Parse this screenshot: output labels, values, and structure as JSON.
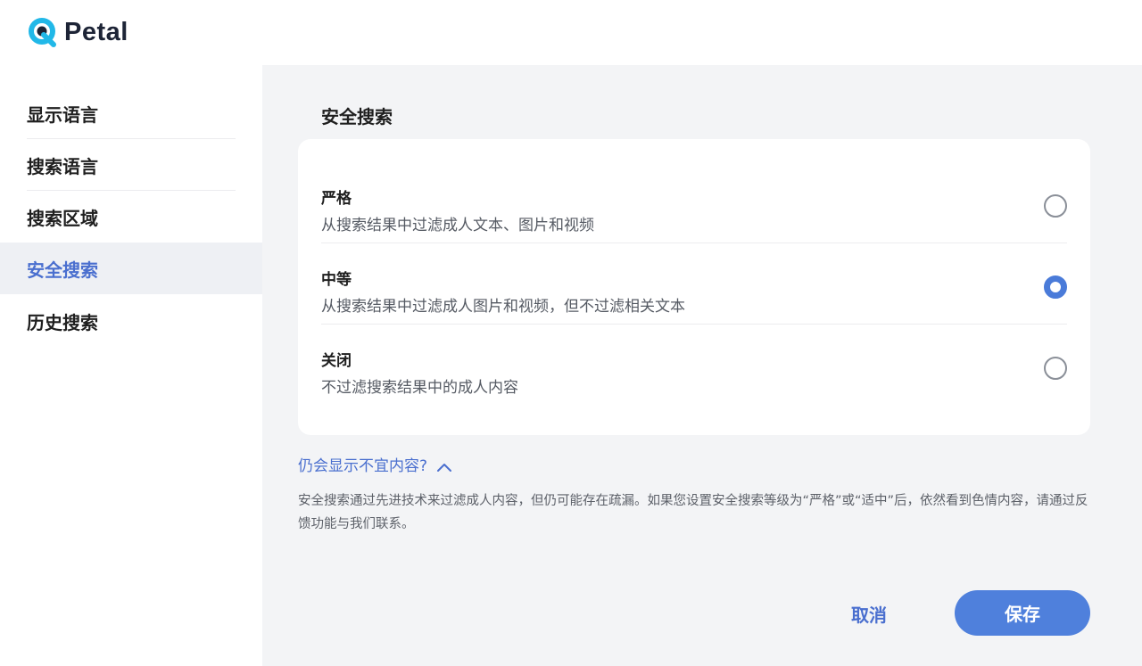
{
  "brand": {
    "name": "Petal",
    "colors": {
      "cyan": "#21b8e8",
      "navy": "#1d2436",
      "accent": "#4a7bd9"
    }
  },
  "sidebar": {
    "items": [
      {
        "label": "显示语言",
        "active": false
      },
      {
        "label": "搜索语言",
        "active": false
      },
      {
        "label": "搜索区域",
        "active": false
      },
      {
        "label": "安全搜索",
        "active": true
      },
      {
        "label": "历史搜索",
        "active": false
      }
    ]
  },
  "main": {
    "title": "安全搜索",
    "options": [
      {
        "title": "严格",
        "description": "从搜索结果中过滤成人文本、图片和视频",
        "selected": false
      },
      {
        "title": "中等",
        "description": "从搜索结果中过滤成人图片和视频，但不过滤相关文本",
        "selected": true
      },
      {
        "title": "关闭",
        "description": "不过滤搜索结果中的成人内容",
        "selected": false
      }
    ],
    "faq_label": "仍会显示不宜内容?",
    "note": "安全搜索通过先进技术来过滤成人内容，但仍可能存在疏漏。如果您设置安全搜索等级为“严格”或“适中”后，依然看到色情内容，请通过反馈功能与我们联系。"
  },
  "actions": {
    "cancel_label": "取消",
    "save_label": "保存"
  }
}
